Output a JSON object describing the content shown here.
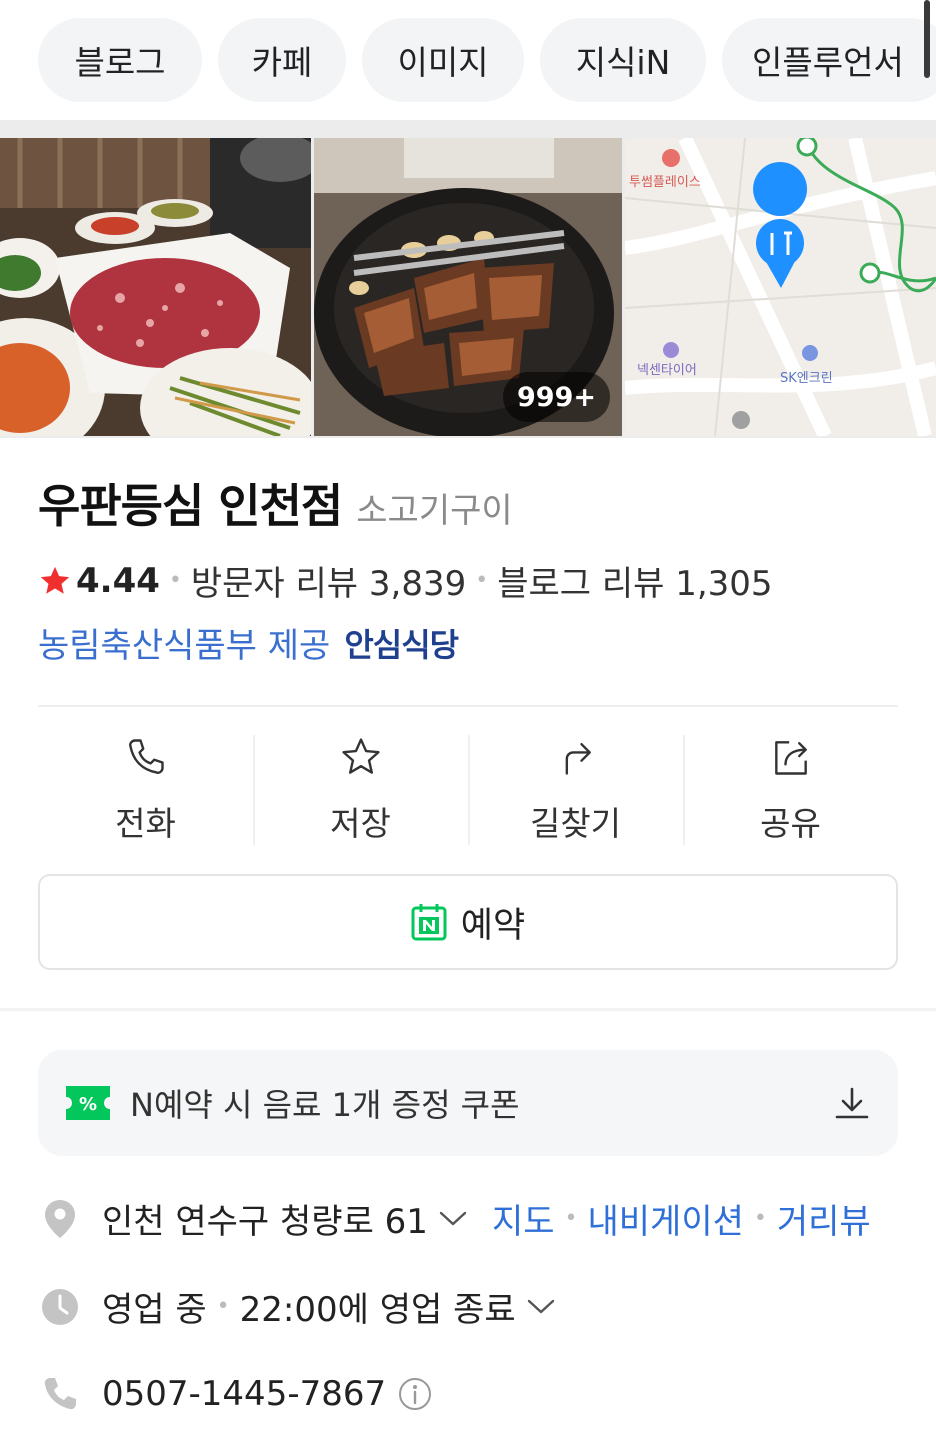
{
  "chips": [
    "블로그",
    "카페",
    "이미지",
    "지식iN",
    "인플루언서"
  ],
  "photos": {
    "count_badge": "999+",
    "map_labels": [
      "투썸플레이스",
      "넥센타이어",
      "SK엔크린"
    ]
  },
  "place": {
    "name": "우판등심 인천점",
    "category": "소고기구이",
    "rating": "4.44",
    "visitor_reviews": "방문자 리뷰 3,839",
    "blog_reviews": "블로그 리뷰 1,305",
    "cert_text": "농림축산식품부 제공",
    "cert_brand": "안심식당"
  },
  "actions": [
    {
      "label": "전화",
      "icon": "phone-icon"
    },
    {
      "label": "저장",
      "icon": "star-outline-icon"
    },
    {
      "label": "길찾기",
      "icon": "directions-icon"
    },
    {
      "label": "공유",
      "icon": "share-icon"
    }
  ],
  "reserve": {
    "label": "예약",
    "icon": "naver-booking-icon"
  },
  "coupon": {
    "label": "N예약 시 음료 1개 증정 쿠폰",
    "icon": "coupon-icon",
    "action_icon": "download-icon"
  },
  "address": {
    "text": "인천 연수구 청량로 61",
    "links": [
      "지도",
      "내비게이션",
      "거리뷰"
    ]
  },
  "hours": {
    "status": "영업 중",
    "detail": "22:00에 영업 종료"
  },
  "phone": {
    "number": "0507-1445-7867"
  },
  "colors": {
    "accent_green": "#03c75a",
    "link_blue": "#2f6fd8",
    "star_red": "#f0302f",
    "map_pin": "#1e90ff"
  }
}
